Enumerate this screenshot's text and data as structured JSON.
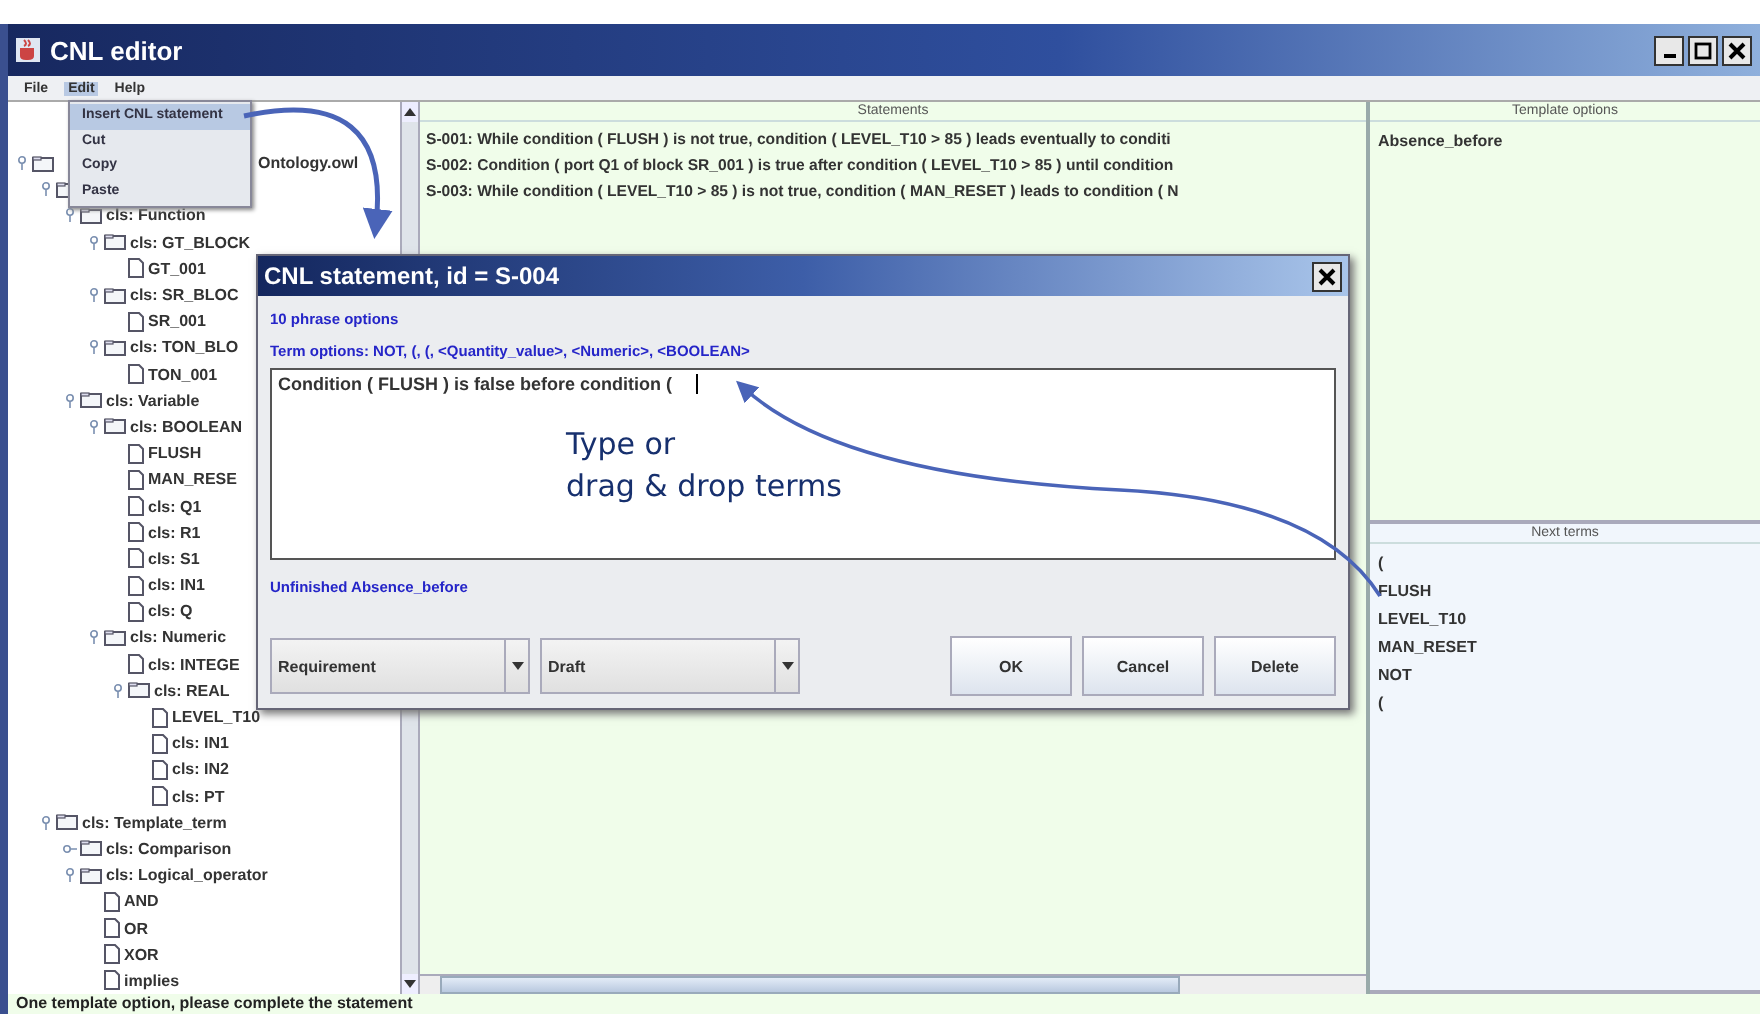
{
  "window": {
    "title": "CNL editor"
  },
  "menu_bar": [
    {
      "label": "File",
      "selected": false
    },
    {
      "label": "Edit",
      "selected": true
    },
    {
      "label": "Help",
      "selected": false
    }
  ],
  "edit_menu": [
    {
      "label": "Insert CNL statement",
      "selected": true
    },
    {
      "label": "Cut",
      "selected": false
    },
    {
      "label": "Copy",
      "selected": false
    },
    {
      "label": "Paste",
      "selected": false
    }
  ],
  "tree": [
    {
      "label": "Ontology.owl",
      "kind": "folder",
      "expanded": true,
      "children": [
        {
          "kind": "folder",
          "expanded": true,
          "children": [
            {
              "label": "cls: Function",
              "kind": "folder",
              "expanded": true,
              "children": [
                {
                  "label": "cls: GT_BLOCK",
                  "kind": "folder",
                  "expanded": true,
                  "children": [
                    {
                      "label": "GT_001",
                      "kind": "file"
                    }
                  ]
                },
                {
                  "label": "cls: SR_BLOC",
                  "kind": "folder",
                  "expanded": true,
                  "children": [
                    {
                      "label": "SR_001",
                      "kind": "file"
                    }
                  ]
                },
                {
                  "label": "cls: TON_BLO",
                  "kind": "folder",
                  "expanded": true,
                  "children": [
                    {
                      "label": "TON_001",
                      "kind": "file"
                    }
                  ]
                }
              ]
            },
            {
              "label": "cls: Variable",
              "kind": "folder",
              "expanded": true,
              "children": [
                {
                  "label": "cls: BOOLEAN",
                  "kind": "folder",
                  "expanded": true,
                  "children": [
                    {
                      "label": "FLUSH",
                      "kind": "file"
                    },
                    {
                      "label": "MAN_RESE",
                      "kind": "file"
                    },
                    {
                      "label": "cls: Q1",
                      "kind": "file"
                    },
                    {
                      "label": "cls: R1",
                      "kind": "file"
                    },
                    {
                      "label": "cls: S1",
                      "kind": "file"
                    },
                    {
                      "label": "cls: IN1",
                      "kind": "file"
                    },
                    {
                      "label": "cls: Q",
                      "kind": "file"
                    }
                  ]
                },
                {
                  "label": "cls: Numeric",
                  "kind": "folder",
                  "expanded": true,
                  "children": [
                    {
                      "label": "cls: INTEGE",
                      "kind": "file"
                    },
                    {
                      "label": "cls: REAL",
                      "kind": "folder",
                      "expanded": true,
                      "children": [
                        {
                          "label": "LEVEL_T10",
                          "kind": "file"
                        },
                        {
                          "label": "cls: IN1",
                          "kind": "file"
                        },
                        {
                          "label": "cls: IN2",
                          "kind": "file"
                        },
                        {
                          "label": "cls: PT",
                          "kind": "file"
                        }
                      ]
                    }
                  ]
                }
              ]
            }
          ]
        },
        {
          "label": "cls: Template_term",
          "kind": "folder",
          "expanded": true,
          "children": [
            {
              "label": "cls: Comparison",
              "kind": "folder",
              "expanded": false
            },
            {
              "label": "cls: Logical_operator",
              "kind": "folder",
              "expanded": true,
              "children": [
                {
                  "label": "AND",
                  "kind": "file"
                },
                {
                  "label": "OR",
                  "kind": "file"
                },
                {
                  "label": "XOR",
                  "kind": "file"
                },
                {
                  "label": "implies",
                  "kind": "file"
                }
              ]
            }
          ]
        }
      ]
    }
  ],
  "statements": {
    "title": "Statements",
    "rows": [
      "S-001:  While condition ( FLUSH ) is not true, condition ( LEVEL_T10 > 85 ) leads eventually to conditi",
      "S-002:  Condition ( port Q1 of block SR_001 ) is true after condition ( LEVEL_T10 > 85 ) until condition",
      "S-003:  While condition ( LEVEL_T10 > 85 ) is not true, condition ( MAN_RESET ) leads to condition ( N"
    ]
  },
  "template_options": {
    "title": "Template options",
    "items": [
      "Absence_before"
    ]
  },
  "next_terms": {
    "title": "Next terms",
    "items": [
      "(",
      "FLUSH",
      "LEVEL_T10",
      "MAN_RESET",
      "NOT",
      "("
    ]
  },
  "dialog": {
    "title": "CNL statement, id = S-004",
    "phrase_options": "10 phrase options",
    "term_options": "Term options: NOT, (, (, <Quantity_value>, <Numeric>, <BOOLEAN>",
    "value": "Condition ( FLUSH ) is false before condition (",
    "status": "Unfinished  Absence_before",
    "type_select": "Requirement",
    "state_select": "Draft",
    "buttons": [
      "OK",
      "Cancel",
      "Delete"
    ]
  },
  "annotation": [
    "Type or",
    "drag & drop terms"
  ],
  "status_bar": "One template option, please complete the statement"
}
